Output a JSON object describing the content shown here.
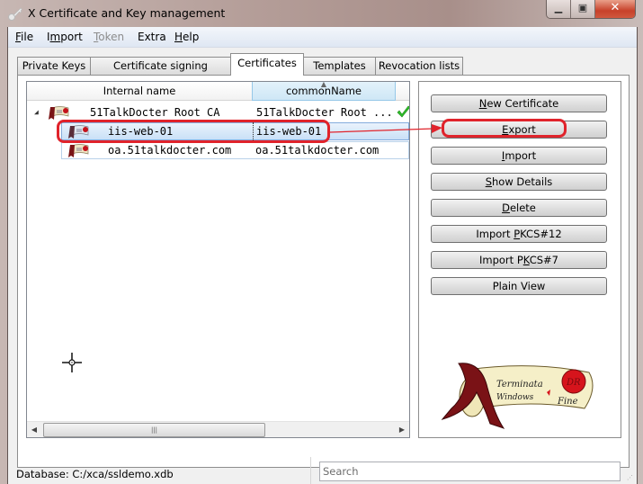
{
  "window": {
    "title": "X Certificate and Key management",
    "app_icon": "key-icon",
    "controls": {
      "minimize": "minimize-icon",
      "maximize": "maximize-icon",
      "close": "close-icon"
    }
  },
  "menubar": {
    "items": [
      {
        "label": "File",
        "mnemonic": "F",
        "enabled": true
      },
      {
        "label": "Import",
        "mnemonic": "m",
        "enabled": true
      },
      {
        "label": "Token",
        "mnemonic": "T",
        "enabled": false
      },
      {
        "label": "Extra",
        "mnemonic": "",
        "enabled": true
      },
      {
        "label": "Help",
        "mnemonic": "H",
        "enabled": true
      }
    ]
  },
  "tabs": [
    {
      "label": "Private Keys",
      "active": false
    },
    {
      "label": "Certificate signing requests",
      "active": false
    },
    {
      "label": "Certificates",
      "active": true
    },
    {
      "label": "Templates",
      "active": false
    },
    {
      "label": "Revocation lists",
      "active": false
    }
  ],
  "certificates": {
    "columns": [
      {
        "label": "Internal name",
        "sorted": false
      },
      {
        "label": "commonName",
        "sorted": true,
        "sort_direction": "ascending"
      }
    ],
    "rows": [
      {
        "internal_name": "51TalkDocter Root CA",
        "common_name": "51TalkDocter Root ...",
        "level": 0,
        "expanded": true,
        "trusted": true,
        "icon": "certificate-scroll-icon"
      },
      {
        "internal_name": "iis-web-01",
        "common_name": "iis-web-01",
        "level": 1,
        "selected": true,
        "icon": "certificate-scroll-icon"
      },
      {
        "internal_name": "oa.51talkdocter.com",
        "common_name": "oa.51talkdocter.com",
        "level": 1,
        "selected": false,
        "icon": "certificate-scroll-icon"
      }
    ],
    "trusted_icon": "checkmark-icon",
    "scrollbar": {
      "thumb_label": "|||"
    }
  },
  "buttons": {
    "new_certificate": {
      "label_pre": "",
      "mnemonic": "N",
      "label_post": "ew Certificate"
    },
    "export": {
      "label_pre": "",
      "mnemonic": "E",
      "label_post": "xport"
    },
    "import": {
      "label_pre": "",
      "mnemonic": "I",
      "label_post": "mport"
    },
    "show_details": {
      "label_pre": "",
      "mnemonic": "S",
      "label_post": "how Details"
    },
    "delete": {
      "label_pre": "",
      "mnemonic": "D",
      "label_post": "elete"
    },
    "import_pkcs12": {
      "label_pre": "Import ",
      "mnemonic": "P",
      "label_post": "KCS#12"
    },
    "import_pkcs7": {
      "label_pre": "Import P",
      "mnemonic": "K",
      "label_post": "CS#7"
    },
    "plain_view": {
      "label_pre": "Plain View",
      "mnemonic": "",
      "label_post": ""
    }
  },
  "logo": {
    "text_line1": "Terminata",
    "text_line2": "Windows",
    "text_line3": "Fine"
  },
  "statusbar": {
    "database": "Database: C:/xca/ssldemo.xdb",
    "search_placeholder": "Search",
    "search_value": ""
  },
  "annotations": {
    "color": "#e0232b",
    "highlighted_row": "iis-web-01",
    "highlighted_button": "Export"
  }
}
